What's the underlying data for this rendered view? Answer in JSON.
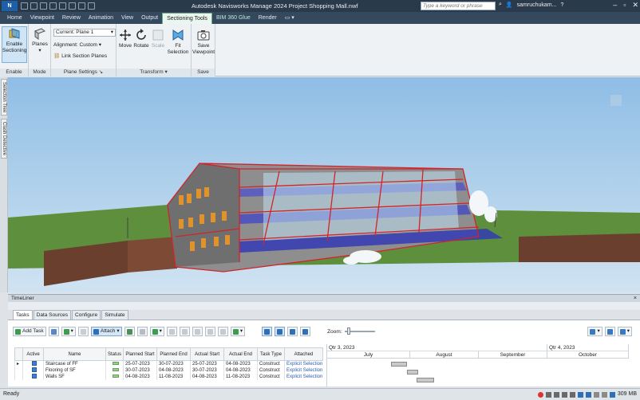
{
  "window": {
    "app_badge": "N",
    "title": "Autodesk Navisworks Manage 2024   Project Shopping Mall.nwf",
    "search_placeholder": "Type a keyword or phrase",
    "user": "samruchukam...",
    "help": "?"
  },
  "tabs": [
    {
      "label": "Home",
      "active": false
    },
    {
      "label": "Viewpoint",
      "active": false
    },
    {
      "label": "Review",
      "active": false
    },
    {
      "label": "Animation",
      "active": false
    },
    {
      "label": "View",
      "active": false
    },
    {
      "label": "Output",
      "active": false
    },
    {
      "label": "Sectioning Tools",
      "active": true
    },
    {
      "label": "BIM 360 Glue",
      "active": false
    },
    {
      "label": "Render",
      "active": false
    }
  ],
  "ribbon": {
    "enable": {
      "button": "Enable Sectioning",
      "title": "Enable"
    },
    "mode": {
      "button": "Planes",
      "title": "Mode"
    },
    "plane_settings": {
      "current": "Current: Plane 1",
      "alignment": "Alignment: Custom",
      "link": "Link Section Planes",
      "title": "Plane Settings"
    },
    "transform": {
      "move": "Move",
      "rotate": "Rotate",
      "scale": "Scale",
      "fit": "Fit Selection",
      "title": "Transform"
    },
    "save": {
      "button": "Save Viewpoint",
      "title": "Save"
    }
  },
  "side_tabs": [
    "Selection Tree",
    "Clash Detective"
  ],
  "timeliner": {
    "title": "TimeLiner",
    "close": "×",
    "tabs": [
      "Tasks",
      "Data Sources",
      "Configure",
      "Simulate"
    ],
    "toolbar": {
      "add_task": "Add Task",
      "attach": "Attach",
      "zoom_label": "Zoom:"
    },
    "zoom_level": 0.1,
    "columns": [
      "Active",
      "Name",
      "Status",
      "Planned Start",
      "Planned End",
      "Actual Start",
      "Actual End",
      "Task Type",
      "Attached"
    ],
    "rows": [
      {
        "name": "Staircase of FF",
        "planned_start": "25-07-2023",
        "planned_end": "30-07-2023",
        "actual_start": "25-07-2023",
        "actual_end": "04-08-2023",
        "type": "Construct",
        "attached": "Explicit Selection"
      },
      {
        "name": "Flooring of SF",
        "planned_start": "30-07-2023",
        "planned_end": "04-08-2023",
        "actual_start": "30-07-2023",
        "actual_end": "04-08-2023",
        "type": "Construct",
        "attached": "Explicit Selection"
      },
      {
        "name": "Walls SF",
        "planned_start": "04-08-2023",
        "planned_end": "11-08-2023",
        "actual_start": "04-08-2023",
        "actual_end": "11-08-2023",
        "type": "Construct",
        "attached": "Explicit Selection"
      }
    ],
    "gantt": {
      "quarters": [
        "Qtr 3, 2023",
        "Qtr 4, 2023"
      ],
      "months": [
        "July",
        "August",
        "September",
        "October"
      ]
    }
  },
  "status": {
    "text": "Ready",
    "memory": "309 MB"
  }
}
